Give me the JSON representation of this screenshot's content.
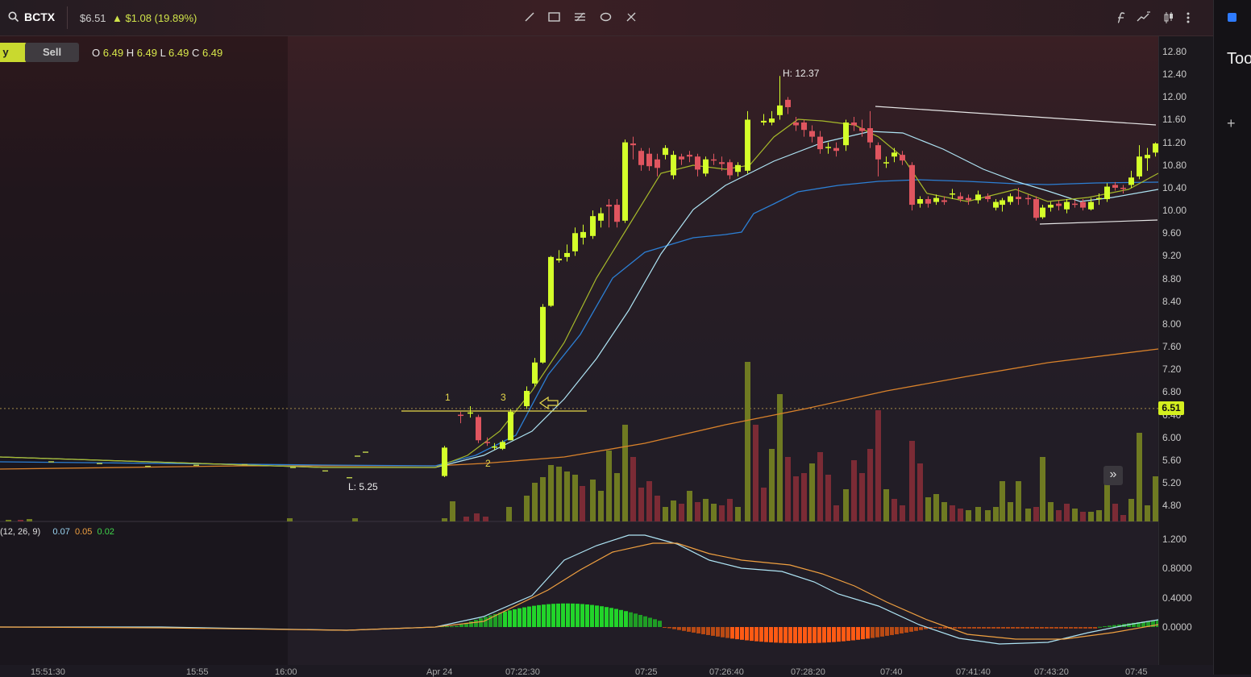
{
  "header": {
    "ticker": "BCTX",
    "price": "$6.51",
    "change": "$1.08 (19.89%)"
  },
  "buttons": {
    "buy": "y",
    "sell": "Sell"
  },
  "ohlc": {
    "o_label": "O",
    "o": "6.49",
    "h_label": "H",
    "h": "6.49",
    "l_label": "L",
    "l": "6.49",
    "c_label": "C",
    "c": "6.49"
  },
  "annotations": {
    "high": "H: 12.37",
    "low": "L: 5.25",
    "n1": "1",
    "n2": "2",
    "n3": "3"
  },
  "price_scale": [
    "12.80",
    "12.40",
    "12.00",
    "11.60",
    "11.20",
    "10.80",
    "10.40",
    "10.00",
    "9.60",
    "9.20",
    "8.80",
    "8.40",
    "8.00",
    "7.60",
    "7.20",
    "6.80",
    "6.40",
    "6.00",
    "5.60",
    "5.20",
    "4.80"
  ],
  "current_price": "6.51",
  "macd": {
    "label": "(12, 26, 9)",
    "v1": "0.07",
    "v2": "0.05",
    "v3": "0.02",
    "scale": [
      "1.200",
      "0.8000",
      "0.4000",
      "0.0000"
    ]
  },
  "time_axis": [
    "15:51:30",
    "15:55",
    "16:00",
    "Apr 24",
    "07:22:30",
    "07:25",
    "07:26:40",
    "07:28:20",
    "07:40",
    "07:41:40",
    "07:43:20",
    "07:45"
  ],
  "side_panel": {
    "label": "Too",
    "plus": "+"
  },
  "colors": {
    "bull": "#d4ff2a",
    "bear": "#e0555f",
    "volBull": "#6f7a22",
    "volBear": "#7b2b35"
  }
}
